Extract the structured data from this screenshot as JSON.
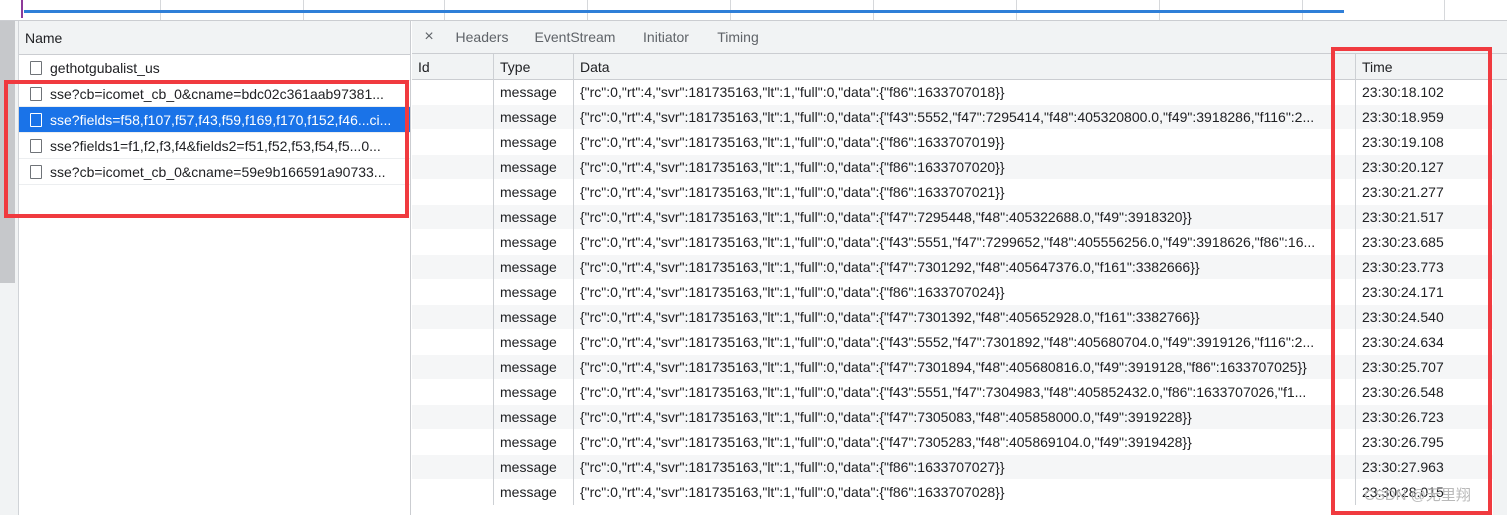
{
  "name_pane": {
    "header": "Name",
    "requests": [
      {
        "name": "gethotgubalist_us",
        "selected": false
      },
      {
        "name": "sse?cb=icomet_cb_0&cname=bdc02c361aab97381...",
        "selected": false
      },
      {
        "name": "sse?fields=f58,f107,f57,f43,f59,f169,f170,f152,f46...ci...",
        "selected": true
      },
      {
        "name": "sse?fields1=f1,f2,f3,f4&fields2=f51,f52,f53,f54,f5...0...",
        "selected": false
      },
      {
        "name": "sse?cb=icomet_cb_0&cname=59e9b166591a90733...",
        "selected": false
      }
    ]
  },
  "tabs": {
    "close_icon": "×",
    "items": [
      "Headers",
      "EventStream",
      "Initiator",
      "Timing"
    ],
    "active": "EventStream"
  },
  "events": {
    "columns": {
      "id": "Id",
      "type": "Type",
      "data": "Data",
      "time": "Time"
    },
    "rows": [
      {
        "id": "",
        "type": "message",
        "data": "{\"rc\":0,\"rt\":4,\"svr\":181735163,\"lt\":1,\"full\":0,\"data\":{\"f86\":1633707018}}",
        "time": "23:30:18.102"
      },
      {
        "id": "",
        "type": "message",
        "data": "{\"rc\":0,\"rt\":4,\"svr\":181735163,\"lt\":1,\"full\":0,\"data\":{\"f43\":5552,\"f47\":7295414,\"f48\":405320800.0,\"f49\":3918286,\"f116\":2...",
        "time": "23:30:18.959"
      },
      {
        "id": "",
        "type": "message",
        "data": "{\"rc\":0,\"rt\":4,\"svr\":181735163,\"lt\":1,\"full\":0,\"data\":{\"f86\":1633707019}}",
        "time": "23:30:19.108"
      },
      {
        "id": "",
        "type": "message",
        "data": "{\"rc\":0,\"rt\":4,\"svr\":181735163,\"lt\":1,\"full\":0,\"data\":{\"f86\":1633707020}}",
        "time": "23:30:20.127"
      },
      {
        "id": "",
        "type": "message",
        "data": "{\"rc\":0,\"rt\":4,\"svr\":181735163,\"lt\":1,\"full\":0,\"data\":{\"f86\":1633707021}}",
        "time": "23:30:21.277"
      },
      {
        "id": "",
        "type": "message",
        "data": "{\"rc\":0,\"rt\":4,\"svr\":181735163,\"lt\":1,\"full\":0,\"data\":{\"f47\":7295448,\"f48\":405322688.0,\"f49\":3918320}}",
        "time": "23:30:21.517"
      },
      {
        "id": "",
        "type": "message",
        "data": "{\"rc\":0,\"rt\":4,\"svr\":181735163,\"lt\":1,\"full\":0,\"data\":{\"f43\":5551,\"f47\":7299652,\"f48\":405556256.0,\"f49\":3918626,\"f86\":16...",
        "time": "23:30:23.685"
      },
      {
        "id": "",
        "type": "message",
        "data": "{\"rc\":0,\"rt\":4,\"svr\":181735163,\"lt\":1,\"full\":0,\"data\":{\"f47\":7301292,\"f48\":405647376.0,\"f161\":3382666}}",
        "time": "23:30:23.773"
      },
      {
        "id": "",
        "type": "message",
        "data": "{\"rc\":0,\"rt\":4,\"svr\":181735163,\"lt\":1,\"full\":0,\"data\":{\"f86\":1633707024}}",
        "time": "23:30:24.171"
      },
      {
        "id": "",
        "type": "message",
        "data": "{\"rc\":0,\"rt\":4,\"svr\":181735163,\"lt\":1,\"full\":0,\"data\":{\"f47\":7301392,\"f48\":405652928.0,\"f161\":3382766}}",
        "time": "23:30:24.540"
      },
      {
        "id": "",
        "type": "message",
        "data": "{\"rc\":0,\"rt\":4,\"svr\":181735163,\"lt\":1,\"full\":0,\"data\":{\"f43\":5552,\"f47\":7301892,\"f48\":405680704.0,\"f49\":3919126,\"f116\":2...",
        "time": "23:30:24.634"
      },
      {
        "id": "",
        "type": "message",
        "data": "{\"rc\":0,\"rt\":4,\"svr\":181735163,\"lt\":1,\"full\":0,\"data\":{\"f47\":7301894,\"f48\":405680816.0,\"f49\":3919128,\"f86\":1633707025}}",
        "time": "23:30:25.707"
      },
      {
        "id": "",
        "type": "message",
        "data": "{\"rc\":0,\"rt\":4,\"svr\":181735163,\"lt\":1,\"full\":0,\"data\":{\"f43\":5551,\"f47\":7304983,\"f48\":405852432.0,\"f86\":1633707026,\"f1...",
        "time": "23:30:26.548"
      },
      {
        "id": "",
        "type": "message",
        "data": "{\"rc\":0,\"rt\":4,\"svr\":181735163,\"lt\":1,\"full\":0,\"data\":{\"f47\":7305083,\"f48\":405858000.0,\"f49\":3919228}}",
        "time": "23:30:26.723"
      },
      {
        "id": "",
        "type": "message",
        "data": "{\"rc\":0,\"rt\":4,\"svr\":181735163,\"lt\":1,\"full\":0,\"data\":{\"f47\":7305283,\"f48\":405869104.0,\"f49\":3919428}}",
        "time": "23:30:26.795"
      },
      {
        "id": "",
        "type": "message",
        "data": "{\"rc\":0,\"rt\":4,\"svr\":181735163,\"lt\":1,\"full\":0,\"data\":{\"f86\":1633707027}}",
        "time": "23:30:27.963"
      },
      {
        "id": "",
        "type": "message",
        "data": "{\"rc\":0,\"rt\":4,\"svr\":181735163,\"lt\":1,\"full\":0,\"data\":{\"f86\":1633707028}}",
        "time": "23:30:28.015"
      }
    ]
  },
  "watermark": "CSDN @无里翔",
  "colors": {
    "selection": "#1a73e8",
    "annotation_red": "#f03a3f",
    "timeline_bar": "#2f7fd8"
  }
}
